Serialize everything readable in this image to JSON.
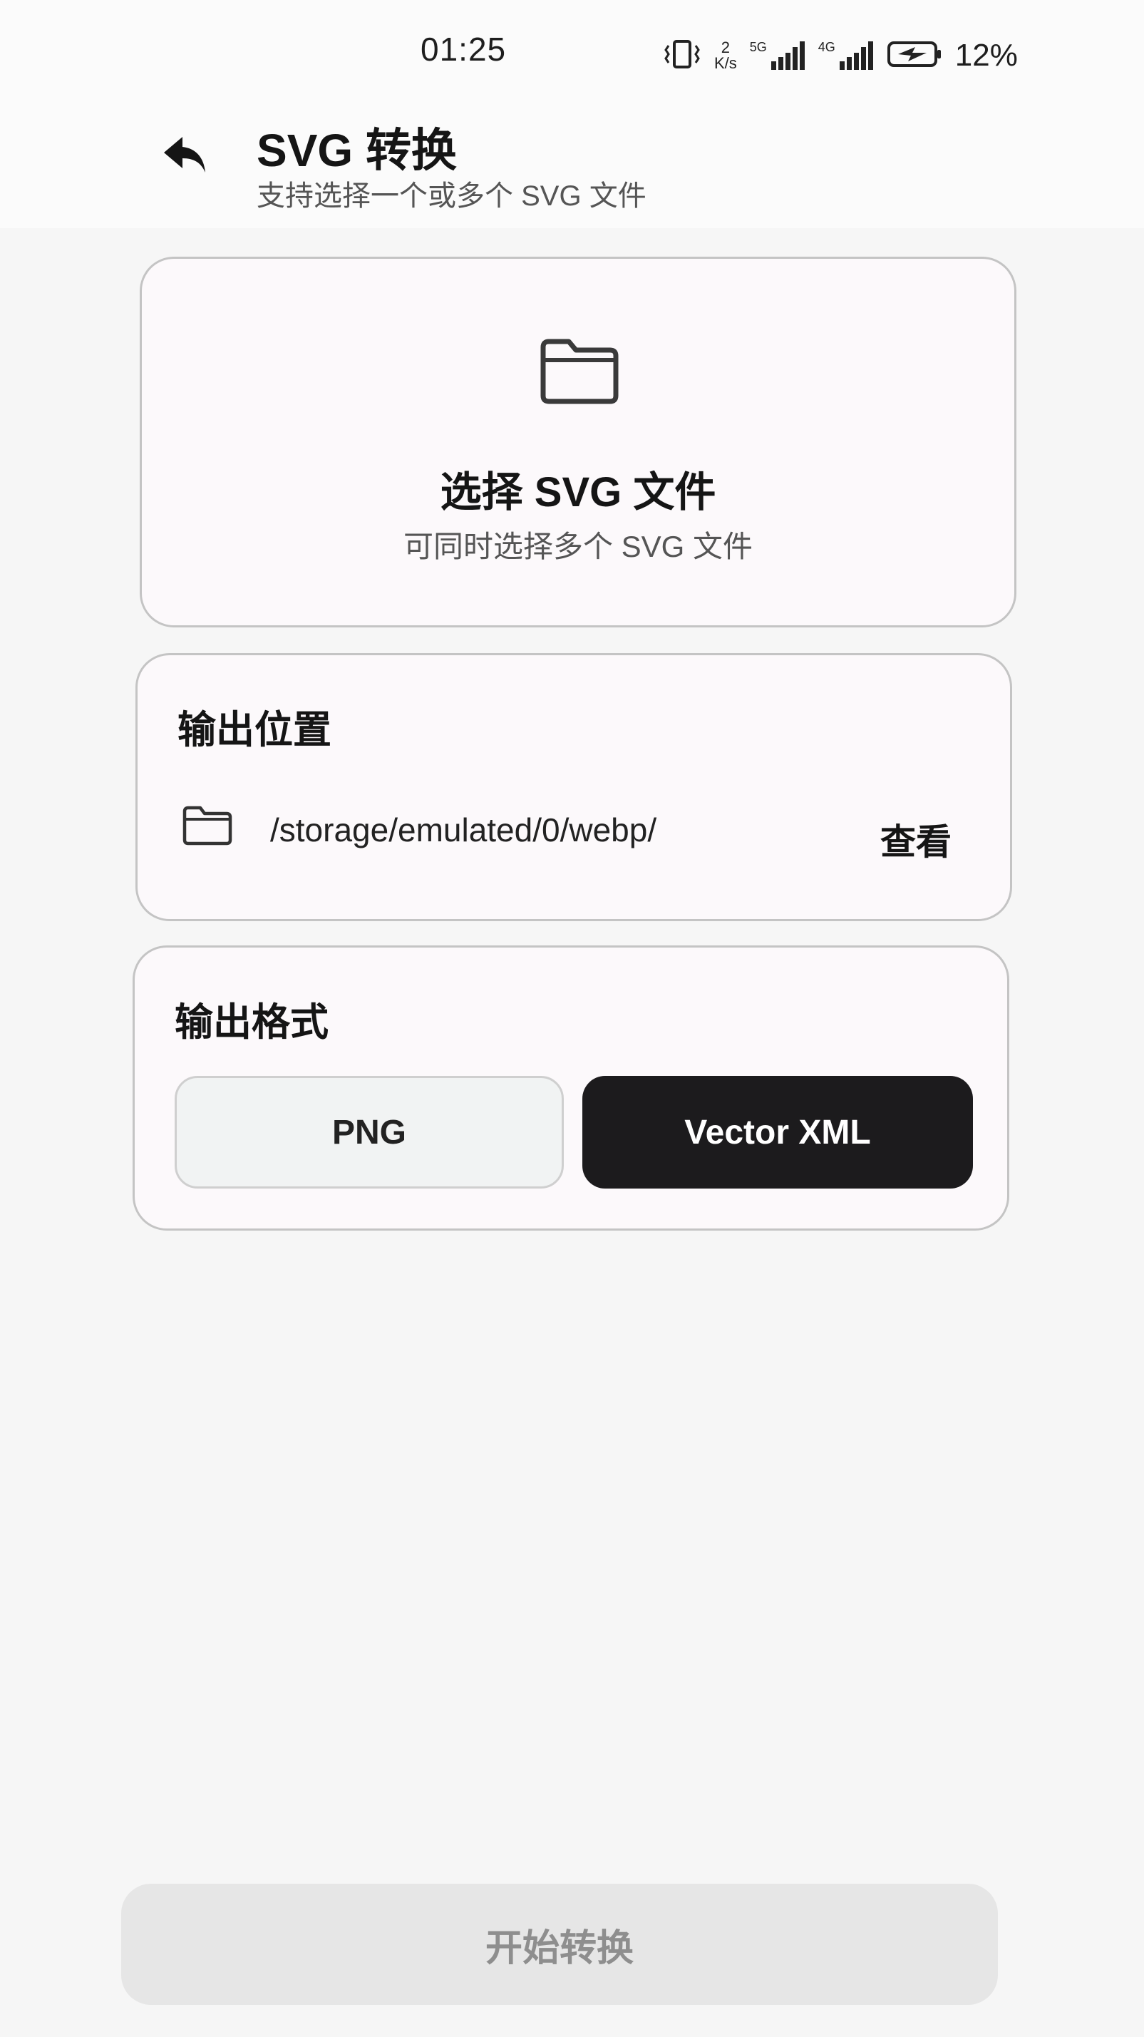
{
  "status_bar": {
    "time": "01:25",
    "net_speed_value": "2",
    "net_speed_unit": "K/s",
    "sim1_label": "5G",
    "sim2_label": "4G",
    "battery": "12%",
    "icons": [
      "vibrate-icon",
      "signal-icon",
      "battery-charging-icon"
    ]
  },
  "header": {
    "title": "SVG 转换",
    "subtitle": "支持选择一个或多个 SVG 文件",
    "back_icon": "back-arrow-icon"
  },
  "pick_card": {
    "icon": "folder-icon",
    "title": "选择 SVG 文件",
    "subtitle": "可同时选择多个 SVG 文件"
  },
  "output_location": {
    "title": "输出位置",
    "icon": "folder-icon",
    "path": "/storage/emulated/0/webp/",
    "view_label": "查看"
  },
  "output_format": {
    "title": "输出格式",
    "options": [
      {
        "label": "PNG",
        "selected": false
      },
      {
        "label": "Vector XML",
        "selected": true
      }
    ]
  },
  "start_button": {
    "label": "开始转换",
    "enabled": false
  },
  "colors": {
    "selected_bg": "#1c1b1d",
    "card_bg": "#fcf9fb",
    "disabled_button_bg": "#e6e6e6"
  }
}
